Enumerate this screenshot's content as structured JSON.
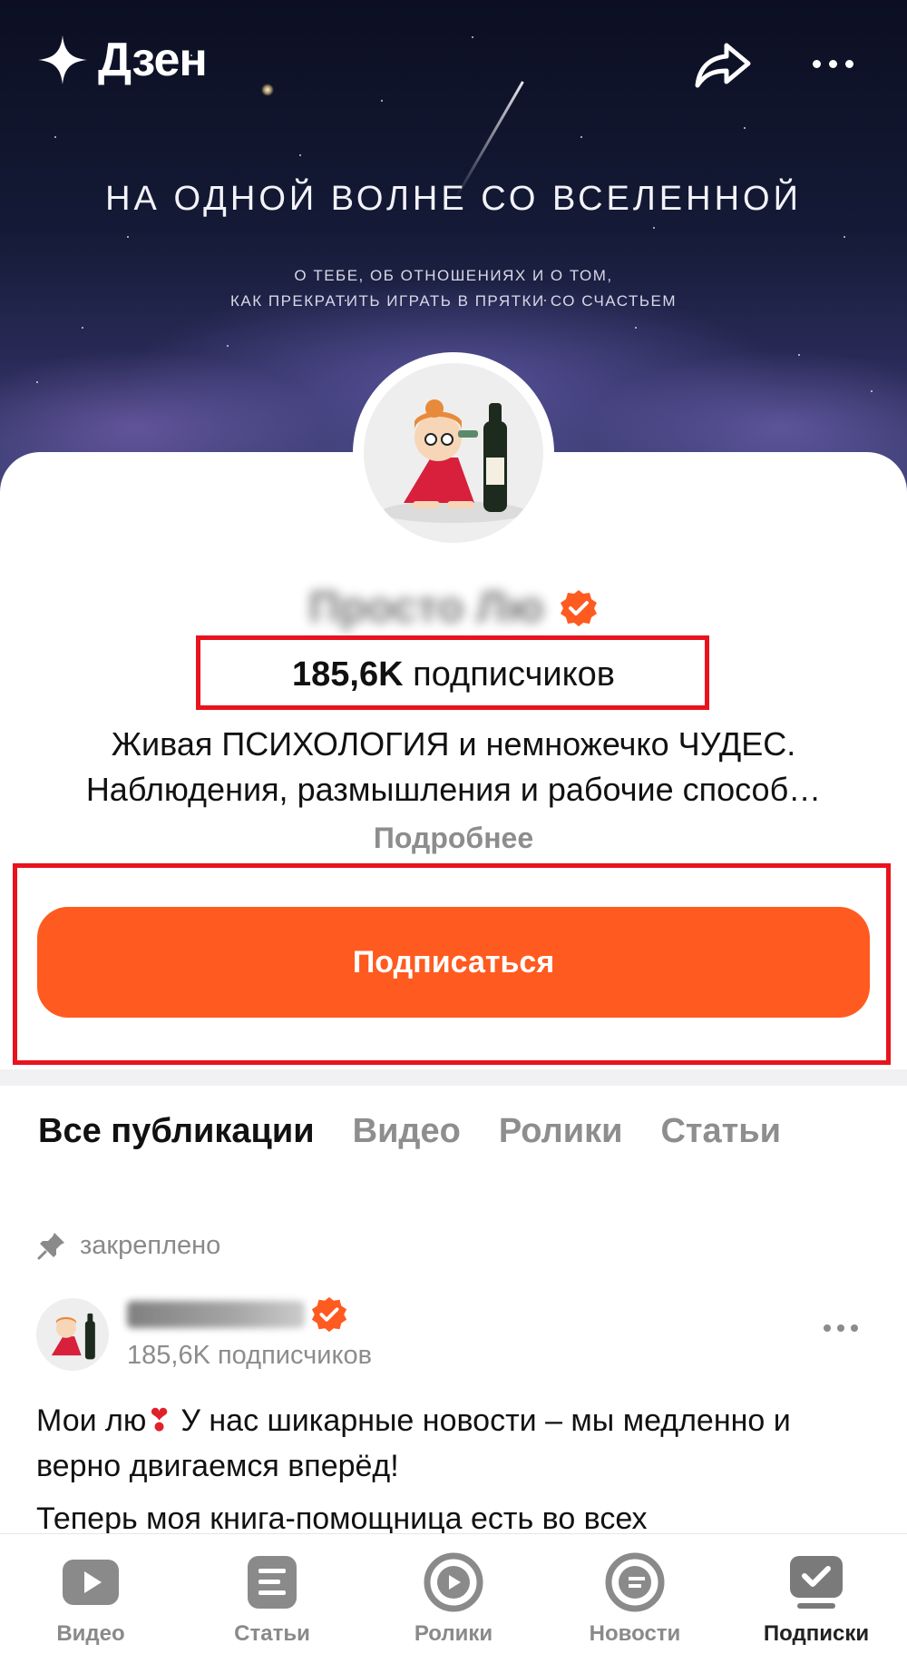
{
  "header": {
    "logo_text": "Дзен",
    "cover_title": "НА ОДНОЙ ВОЛНЕ СО ВСЕЛЕННОЙ",
    "cover_subtitle_line1": "О ТЕБЕ, ОБ ОТНОШЕНИЯХ И О ТОМ,",
    "cover_subtitle_line2": "КАК ПРЕКРАТИТЬ ИГРАТЬ В ПРЯТКИ СО СЧАСТЬЕМ",
    "icons": [
      "sparkle-icon",
      "share-icon",
      "more-icon"
    ]
  },
  "channel": {
    "name": "Просто Лю",
    "subscribers_count": "185,6K",
    "subscribers_label": "подписчиков",
    "description_line1": "Живая ПСИХОЛОГИЯ и немножечко ЧУДЕС.",
    "description_line2": "Наблюдения, размышления и рабочие способ…",
    "more_link": "Подробнее",
    "subscribe_label": "Подписаться",
    "accent_color": "#ff5a1f",
    "highlight_color": "#e8131d"
  },
  "tabs": [
    {
      "label": "Все публикации",
      "active": true
    },
    {
      "label": "Видео",
      "active": false
    },
    {
      "label": "Ролики",
      "active": false
    },
    {
      "label": "Статьи",
      "active": false
    }
  ],
  "post": {
    "pinned_label": "закреплено",
    "author_subscribers": "185,6K подписчиков",
    "text_part1": "Мои лю",
    "heart": "❣",
    "text_part2": " У нас шикарные новости – мы медленно и верно двигаемся вперёд!",
    "text_cut": "Теперь моя книга-помощница есть во всех"
  },
  "bottom_nav": [
    {
      "label": "Видео",
      "icon": "video-icon",
      "active": false
    },
    {
      "label": "Статьи",
      "icon": "articles-icon",
      "active": false
    },
    {
      "label": "Ролики",
      "icon": "clips-icon",
      "active": false
    },
    {
      "label": "Новости",
      "icon": "news-icon",
      "active": false
    },
    {
      "label": "Подписки",
      "icon": "subscriptions-icon",
      "active": true
    }
  ]
}
